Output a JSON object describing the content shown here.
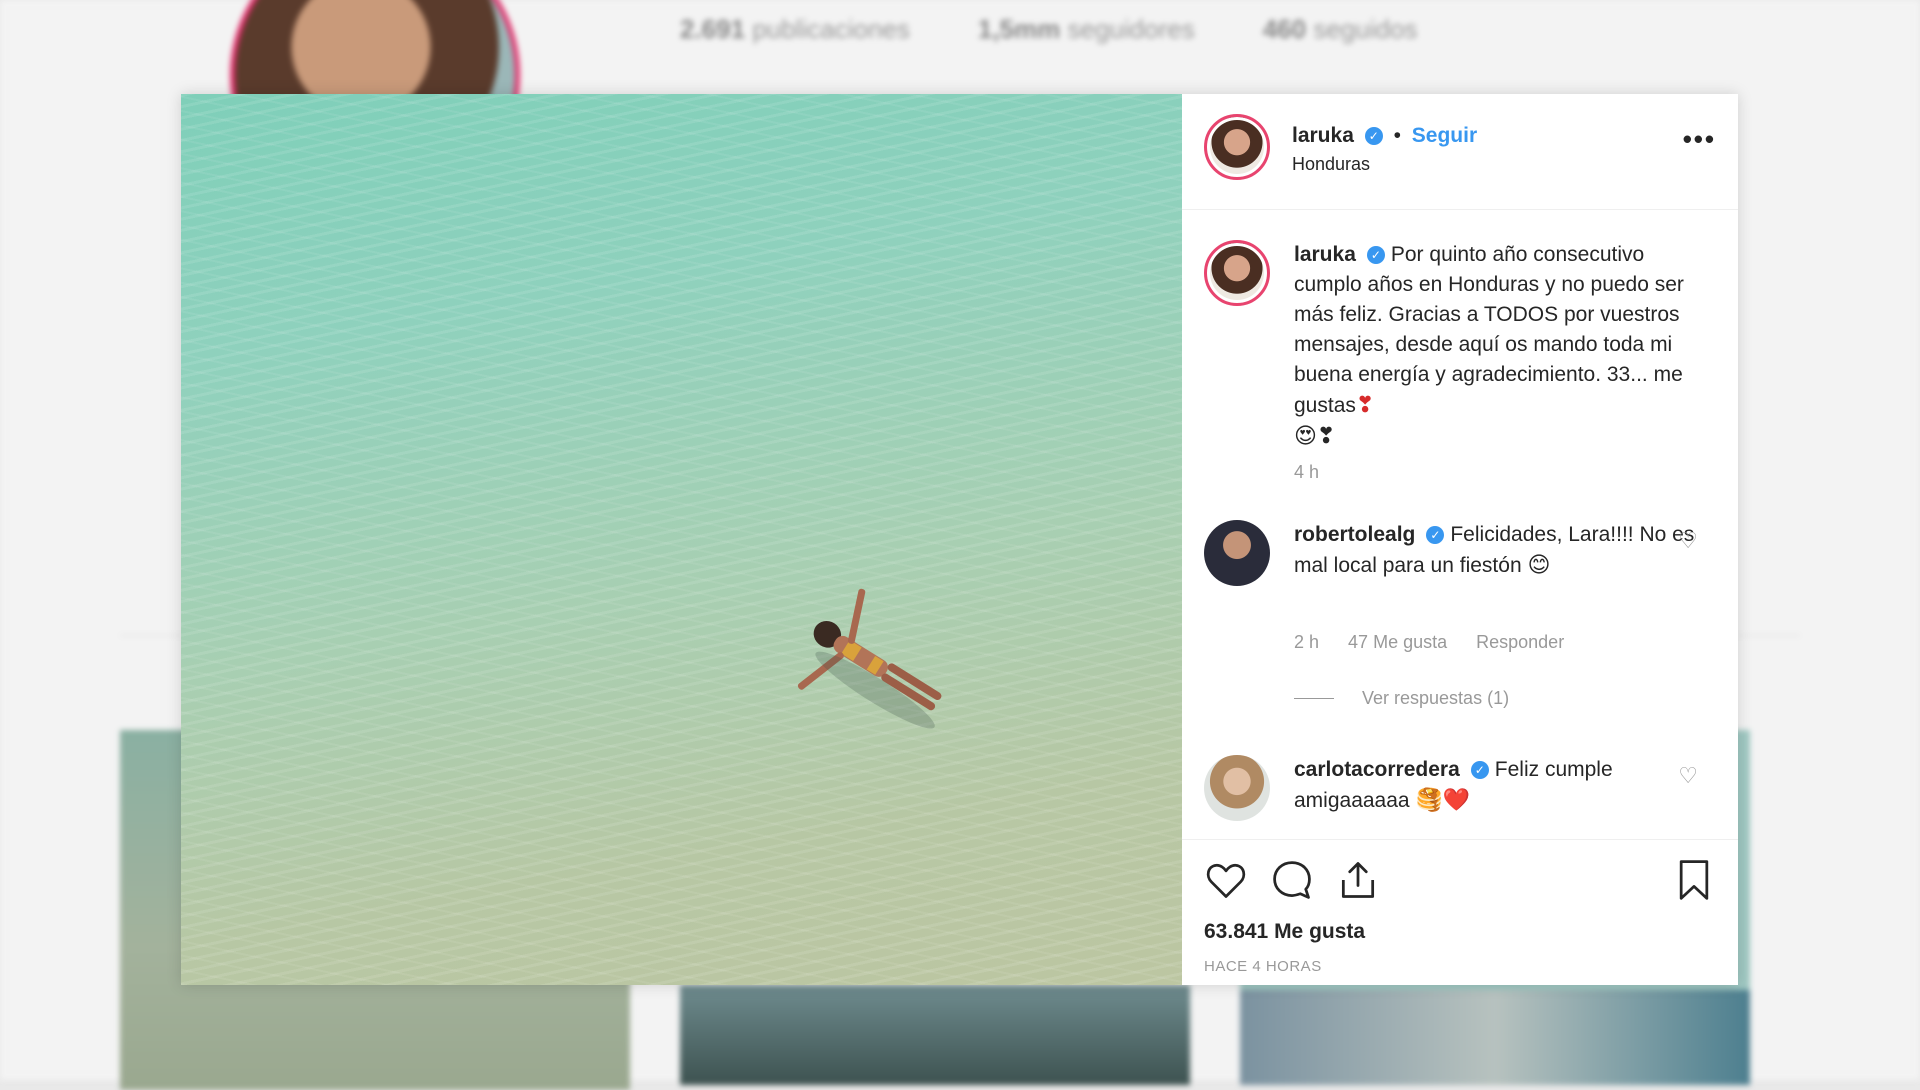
{
  "background": {
    "stats": [
      {
        "value": "2.691",
        "label": "publicaciones"
      },
      {
        "value": "1,5mm",
        "label": "seguidores"
      },
      {
        "value": "460",
        "label": "seguidos"
      }
    ]
  },
  "post": {
    "username": "laruka",
    "follow_label": "Seguir",
    "location": "Honduras",
    "more_icon": "more-options-icon",
    "caption": {
      "username": "laruka",
      "text": "Por quinto año consecutivo cumplo años en Honduras y no puedo ser más feliz. Gracias a TODOS por vuestros mensajes, desde aquí os mando toda mi buena energía y agradecimiento. 33... me gustas",
      "emojis_inline": "❣",
      "emojis_line": "😍❣",
      "time": "4 h"
    },
    "comments": [
      {
        "username": "robertolealg",
        "text": "Felicidades, Lara!!!! No es mal local para un fiestón",
        "emoji": "😊",
        "time": "2 h",
        "likes": "47 Me gusta",
        "reply": "Responder",
        "view_replies": "Ver respuestas (1)"
      },
      {
        "username": "carlotacorredera",
        "text": "Feliz cumple amigaaaaaa",
        "emoji": "🥞❤️"
      }
    ],
    "likes_count": "63.841 Me gusta",
    "time_ago": "HACE 4 HORAS"
  },
  "colors": {
    "accent": "#3897f0",
    "ring": "#e8446f",
    "muted": "#999999"
  }
}
